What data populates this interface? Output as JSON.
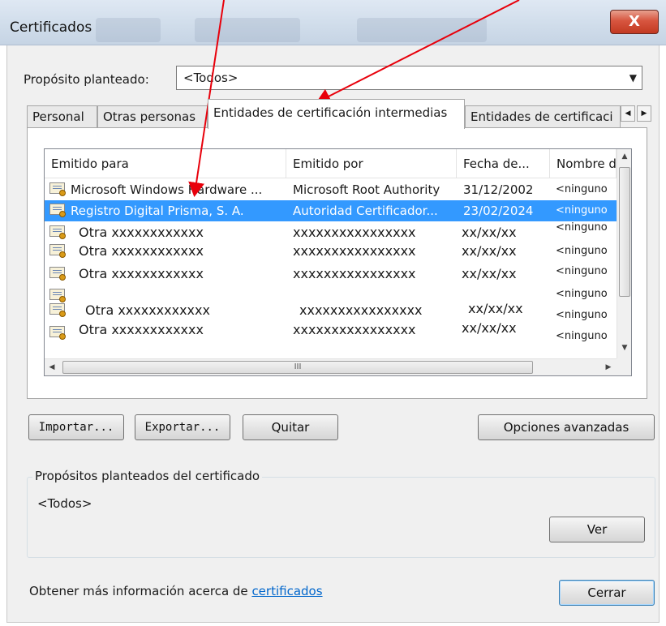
{
  "window": {
    "title": "Certificados",
    "close_glyph": "X"
  },
  "purpose": {
    "label": "Propósito planteado:",
    "selected": "<Todos>"
  },
  "tabs": [
    {
      "label": "Personal"
    },
    {
      "label": "Otras personas"
    },
    {
      "label": "Entidades de certificación intermedias",
      "active": true
    },
    {
      "label": "Entidades de certificaci"
    }
  ],
  "list": {
    "columns": [
      "Emitido para",
      "Emitido por",
      "Fecha de...",
      "Nombre d"
    ],
    "rows": [
      {
        "issued_to": "Microsoft Windows Hardware ...",
        "issued_by": "Microsoft Root Authority",
        "date": "31/12/2002",
        "name": "<ninguno"
      },
      {
        "issued_to": "Registro Digital Prisma, S. A.",
        "issued_by": "Autoridad Certificador...",
        "date": "23/02/2024",
        "name": "<ninguno",
        "selected": true
      },
      {
        "issued_to": "Otra xxxxxxxxxxxx",
        "issued_by": "xxxxxxxxxxxxxxxx",
        "date": "xx/xx/xx",
        "name": "<ninguno"
      },
      {
        "issued_to": "Otra xxxxxxxxxxxx",
        "issued_by": "xxxxxxxxxxxxxxxx",
        "date": "xx/xx/xx",
        "name": "<ninguno"
      },
      {
        "issued_to": "Otra xxxxxxxxxxxx",
        "issued_by": "xxxxxxxxxxxxxxxx",
        "date": "xx/xx/xx",
        "name": "<ninguno"
      },
      {
        "issued_to": "Otra xxxxxxxxxxxx",
        "issued_by": "xxxxxxxxxxxxxxxx",
        "date": "xx/xx/xx",
        "name": "<ninguno"
      },
      {
        "issued_to": "Otra xxxxxxxxxxxx",
        "issued_by": "xxxxxxxxxxxxxxxx",
        "date": "xx/xx/xx",
        "name": "<ninguno"
      }
    ],
    "extra_name_cell": "<ninguno",
    "hscroll_grip": "III"
  },
  "buttons": {
    "import": "Importar...",
    "export": "Exportar...",
    "remove": "Quitar",
    "advanced": "Opciones avanzadas",
    "view": "Ver",
    "close": "Cerrar"
  },
  "purposes_group": {
    "title": "Propósitos planteados del certificado",
    "value": "<Todos>"
  },
  "footer": {
    "text": "Obtener más información acerca de ",
    "link": "certificados"
  },
  "icons": {
    "certificate": "certificate-icon",
    "dropdown": "chevron-down-icon",
    "tab_left": "chevron-left-icon",
    "tab_right": "chevron-right-icon"
  },
  "colors": {
    "selection": "#3399ff",
    "annotation_arrow": "#e8000b",
    "link": "#0066cc"
  }
}
